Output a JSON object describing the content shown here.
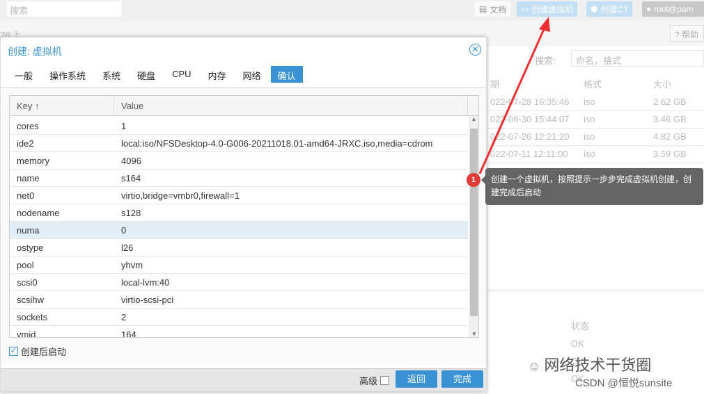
{
  "topbar": {
    "search_placeholder": "搜索",
    "docs": "文档",
    "create_vm": "创建虚拟机",
    "create_ct": "创建CT",
    "user": "root@pam"
  },
  "background": {
    "breadcrumb": "28'上",
    "help": "帮助",
    "search_label": "搜索:",
    "search_placeholder": "命名，格式",
    "columns": [
      "期",
      "格式",
      "大小"
    ],
    "rows": [
      [
        "022-07-28 16:35:46",
        "iso",
        "2.62 GB"
      ],
      [
        "022-06-30 15:44:07",
        "iso",
        "3.46 GB"
      ],
      [
        "022-07-26 12:21:20",
        "iso",
        "4.82 GB"
      ],
      [
        "022-07-11 12:11:00",
        "iso",
        "3.59 GB"
      ]
    ],
    "status_header": "状态",
    "status_rows": [
      "OK",
      "OK",
      "OK"
    ]
  },
  "dialog": {
    "title": "创建: 虚拟机",
    "tabs": [
      "一般",
      "操作系统",
      "系统",
      "硬盘",
      "CPU",
      "内存",
      "网络",
      "确认"
    ],
    "active_tab": "确认",
    "columns": {
      "key": "Key ↑",
      "value": "Value"
    },
    "rows": [
      [
        "cores",
        "1"
      ],
      [
        "ide2",
        "local:iso/NFSDesktop-4.0-G006-20211018.01-amd64-JRXC.iso,media=cdrom"
      ],
      [
        "memory",
        "4096"
      ],
      [
        "name",
        "s164"
      ],
      [
        "net0",
        "virtio,bridge=vmbr0,firewall=1"
      ],
      [
        "nodename",
        "s128"
      ],
      [
        "numa",
        "0"
      ],
      [
        "ostype",
        "l26"
      ],
      [
        "pool",
        "yhvm"
      ],
      [
        "scsi0",
        "local-lvm:40"
      ],
      [
        "scsihw",
        "virtio-scsi-pci"
      ],
      [
        "sockets",
        "2"
      ],
      [
        "vmid",
        "164"
      ]
    ],
    "selected_row": "numa",
    "start_after_create": {
      "label": "创建后启动",
      "checked": true
    },
    "advanced": {
      "label": "高级",
      "checked": false
    },
    "back": "返回",
    "finish": "完成"
  },
  "annotation": {
    "number": "1",
    "text": "创建一个虚拟机，按照提示一步步完成虚拟机创建，创建完成后启动"
  },
  "watermark": {
    "line1": "网络技术干货圈",
    "line2": "CSDN @恒悦sunsite"
  },
  "colors": {
    "accent": "#3892d4",
    "annotation_red": "#e53935",
    "tooltip": "#646464"
  }
}
